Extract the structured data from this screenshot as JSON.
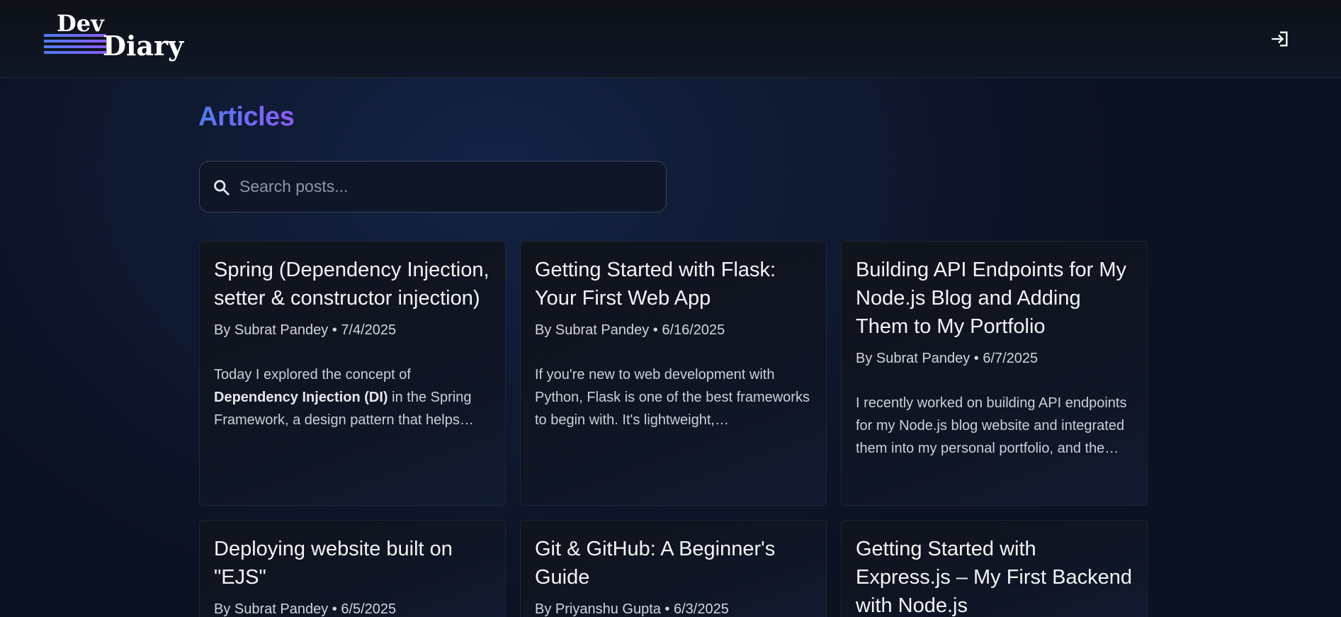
{
  "header": {
    "logo_top": "Dev",
    "logo_bottom": "Diary",
    "login_icon": "login-icon"
  },
  "main": {
    "title": "Articles",
    "search": {
      "placeholder": "Search posts...",
      "value": "",
      "icon": "search-icon"
    },
    "posts": [
      {
        "title": "Spring (Dependency Injection, setter & constructor injection)",
        "meta": "By Subrat Pandey • 7/4/2025",
        "excerpt_before": "Today I explored the concept of ",
        "excerpt_bold": "Dependency Injection (DI)",
        "excerpt_after": " in the Spring Framework, a design pattern that helps…"
      },
      {
        "title": "Getting Started with Flask: Your First Web App",
        "meta": "By Subrat Pandey • 6/16/2025",
        "excerpt_before": "If you're new to web development with Python, Flask is one of the best frameworks to begin with. It's lightweight,…",
        "excerpt_bold": "",
        "excerpt_after": ""
      },
      {
        "title": "Building API Endpoints for My Node.js Blog and Adding Them to My Portfolio",
        "meta": "By Subrat Pandey • 6/7/2025",
        "excerpt_before": "I recently worked on building API endpoints for my Node.js blog website and integrated them into my personal portfolio, and the…",
        "excerpt_bold": "",
        "excerpt_after": ""
      },
      {
        "title": "Deploying website built on \"EJS\"",
        "meta": "By Subrat Pandey • 6/5/2025",
        "excerpt_before": "",
        "excerpt_bold": "",
        "excerpt_after": ""
      },
      {
        "title": "Git & GitHub: A Beginner's Guide",
        "meta": "By Priyanshu Gupta • 6/3/2025",
        "excerpt_before": "",
        "excerpt_bold": "",
        "excerpt_after": ""
      },
      {
        "title": "Getting Started with Express.js – My First Backend with Node.js",
        "meta": "",
        "excerpt_before": "",
        "excerpt_bold": "",
        "excerpt_after": ""
      }
    ]
  },
  "colors": {
    "accent_start": "#4f7cf0",
    "accent_end": "#8b5cf6",
    "background": "#0f1a33"
  }
}
